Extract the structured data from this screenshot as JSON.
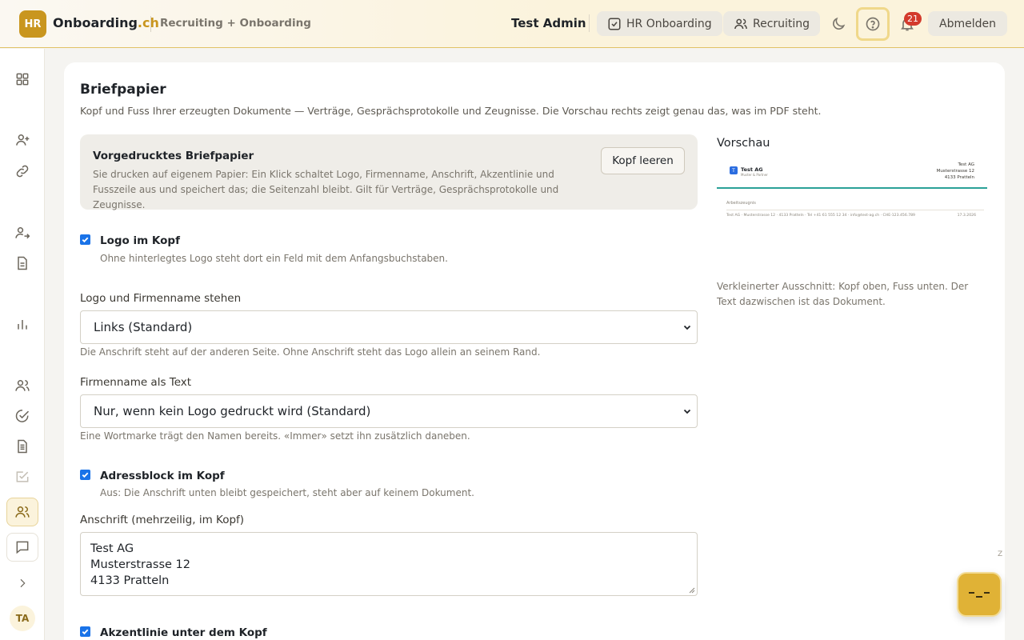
{
  "header": {
    "logo_text": "HR",
    "brand_main": "Onboarding",
    "brand_accent": ".ch",
    "subtitle": "Recruiting + Onboarding",
    "user_name": "Test Admin",
    "btn_onboarding": "HR Onboarding",
    "btn_recruiting": "Recruiting",
    "notification_count": "21",
    "logout": "Abmelden",
    "icons": [
      "moon-icon",
      "help-icon",
      "bell-icon"
    ]
  },
  "sidebar": {
    "items": [
      "grid-icon",
      "user-plus-icon",
      "link-icon",
      "user-export-icon",
      "document-icon",
      "bar-chart-icon",
      "users-icon",
      "check-circle-icon",
      "document-icon",
      "checkbox-edit-icon",
      "users-icon",
      "chat-icon",
      "chevron-right-icon"
    ],
    "avatar": "TA"
  },
  "main": {
    "title": "Briefpapier",
    "description": "Kopf und Fuss Ihrer erzeugten Dokumente — Verträge, Gesprächsprotokolle und Zeugnisse. Die Vorschau rechts zeigt genau das, was im PDF steht.",
    "preprinted": {
      "title": "Vorgedrucktes Briefpapier",
      "text": "Sie drucken auf eigenem Papier: Ein Klick schaltet Logo, Firmenname, Anschrift, Akzentlinie und Fusszeile aus und speichert das; die Seitenzahl bleibt. Gilt für Verträge, Gesprächsprotokolle und Zeugnisse.",
      "button": "Kopf leeren"
    },
    "logo_in_header": {
      "label": "Logo im Kopf",
      "checked": true,
      "hint": "Ohne hinterlegtes Logo steht dort ein Feld mit dem Anfangsbuchstaben."
    },
    "logo_position": {
      "label": "Logo und Firmenname stehen",
      "value": "Links (Standard)",
      "hint": "Die Anschrift steht auf der anderen Seite. Ohne Anschrift steht das Logo allein an seinem Rand."
    },
    "company_text": {
      "label": "Firmenname als Text",
      "value": "Nur, wenn kein Logo gedruckt wird (Standard)",
      "hint": "Eine Wortmarke trägt den Namen bereits. «Immer» setzt ihn zusätzlich daneben."
    },
    "address_block": {
      "label": "Adressblock im Kopf",
      "checked": true,
      "hint": "Aus: Die Anschrift unten bleibt gespeichert, steht aber auf keinem Dokument."
    },
    "address": {
      "label": "Anschrift (mehrzeilig, im Kopf)",
      "lines": [
        "Test AG",
        "Musterstrasse 12",
        "4133 Pratteln"
      ]
    },
    "accent_line": {
      "label": "Akzentlinie unter dem Kopf",
      "checked": true
    }
  },
  "preview": {
    "label": "Vorschau",
    "logo_letter": "T",
    "company": "Test AG",
    "company_sub": "Muster & Partner",
    "address_lines": [
      "Test AG",
      "Musterstrasse 12",
      "4133 Pratteln"
    ],
    "doc_type": "Arbeitszeugnis",
    "footer": "Test AG · Musterstrasse 12 · 4133 Pratteln · Tel +41 61 555 12 34 · info@test-ag.ch · CHE-123.456.789",
    "date": "17.3.2026",
    "caption": "Verkleinerter Ausschnitt: Kopf oben, Fuss unten. Der Text dazwischen ist das Dokument.",
    "accent_color": "#2aa198"
  },
  "misc": {
    "z_mark": "Z",
    "fab_icon": "assistant-face-icon"
  }
}
